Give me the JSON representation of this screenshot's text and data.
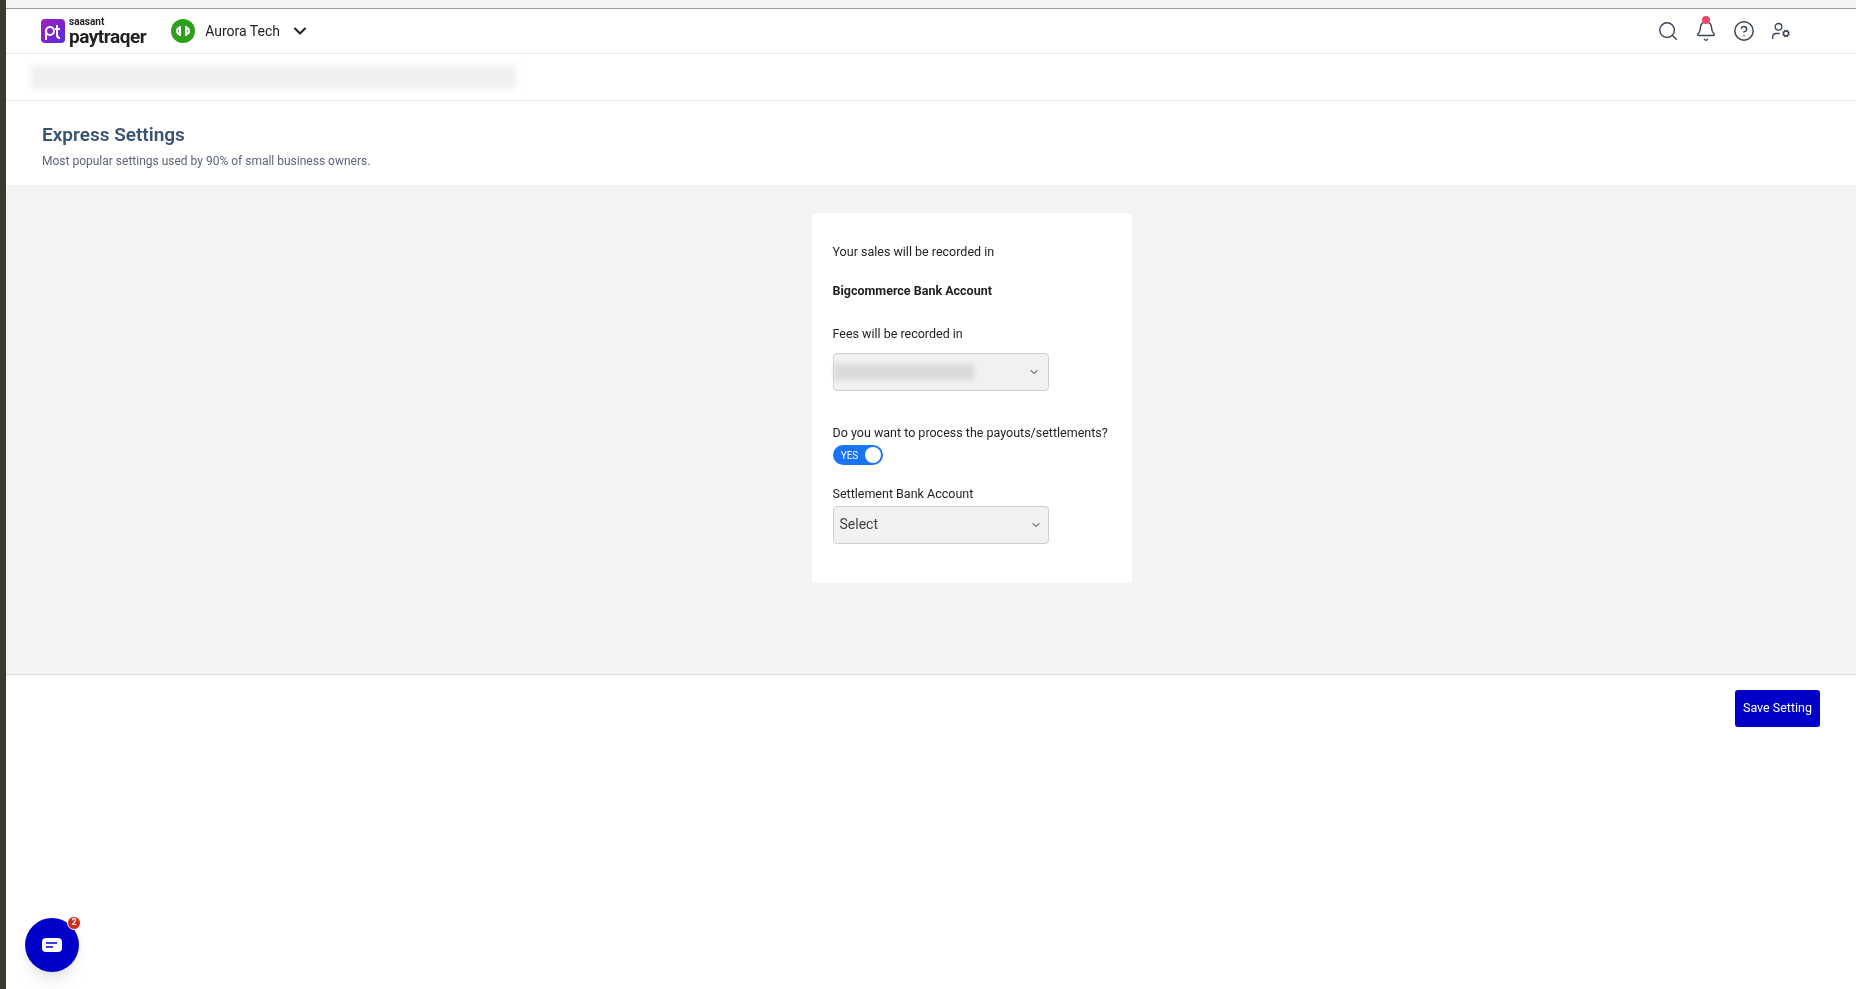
{
  "header": {
    "brand_top": "saasant",
    "brand": "paytraqer",
    "company": "Aurora Tech",
    "notifications_unread": true
  },
  "page": {
    "title": "Express Settings",
    "subtitle": "Most popular settings used by 90% of small business owners."
  },
  "form": {
    "sales_label": "Your sales will be recorded in",
    "sales_account": "Bigcommerce Bank Account",
    "fees_label": "Fees will be recorded in",
    "payout_question": "Do you want to process the payouts/settlements?",
    "payout_toggle": {
      "label": "YES",
      "on": true
    },
    "settlement_label": "Settlement Bank Account",
    "settlement_select": {
      "placeholder": "Select"
    }
  },
  "footer": {
    "save_button": "Save Setting"
  },
  "chat": {
    "badge": "2"
  }
}
